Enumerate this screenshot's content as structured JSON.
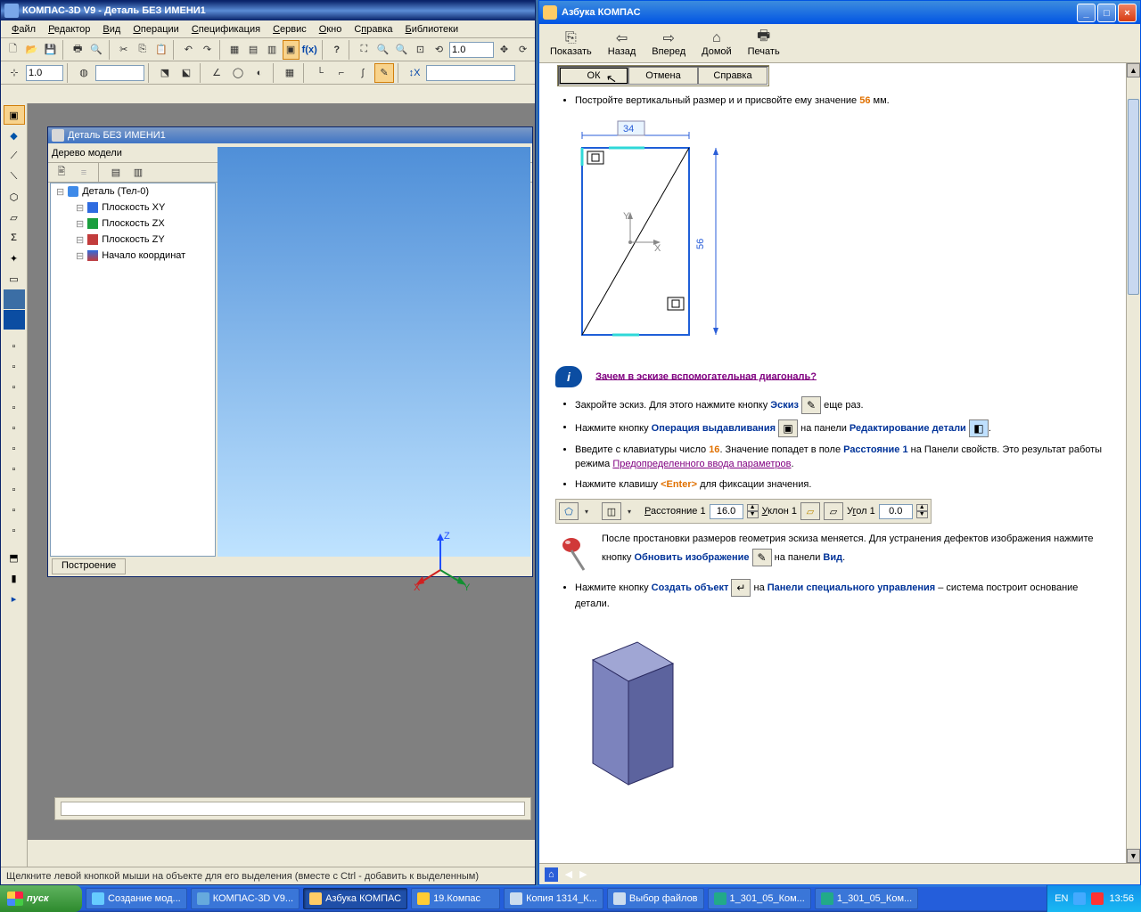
{
  "kompas": {
    "title": "КОМПАС-3D V9 - Деталь БЕЗ ИМЕНИ1",
    "menu": [
      "Файл",
      "Редактор",
      "Вид",
      "Операции",
      "Спецификация",
      "Сервис",
      "Окно",
      "Справка",
      "Библиотеки"
    ],
    "menu_underline": [
      0,
      0,
      0,
      0,
      0,
      0,
      0,
      1,
      0
    ],
    "zoom_input": "1.0",
    "tool_input1": "1.0",
    "mdi_title": "Деталь БЕЗ ИМЕНИ1",
    "tree_title": "Дерево модели",
    "tree_nodes": [
      {
        "label": "Деталь (Тел-0)",
        "cls": "part",
        "indent": 0
      },
      {
        "label": "Плоскость XY",
        "cls": "xy",
        "indent": 1
      },
      {
        "label": "Плоскость ZX",
        "cls": "zx",
        "indent": 1
      },
      {
        "label": "Плоскость ZY",
        "cls": "zy",
        "indent": 1
      },
      {
        "label": "Начало координат",
        "cls": "orig",
        "indent": 1
      }
    ],
    "tab": "Построение",
    "status": "Щелкните левой кнопкой мыши на объекте для его выделения (вместе с Ctrl - добавить к выделенным)",
    "axis_labels": {
      "x": "X",
      "y": "Y",
      "z": "Z"
    }
  },
  "help": {
    "title": "Азбука КОМПАС",
    "toolbar": [
      {
        "label": "Показать",
        "glyph": "⎘"
      },
      {
        "label": "Назад",
        "glyph": "⇦"
      },
      {
        "label": "Вперед",
        "glyph": "⇨"
      },
      {
        "label": "Домой",
        "glyph": "⌂"
      },
      {
        "label": "Печать",
        "glyph": "🖶"
      }
    ],
    "dlg": {
      "ok": "ОК",
      "cancel": "Отмена",
      "help": "Справка"
    },
    "dim_top": "34",
    "dim_right": "56",
    "axis_y": "Y",
    "axis_x": "X",
    "li1a": "Постройте вертикальный размер и и присвойте ему значение ",
    "li1b": "56",
    "li1c": " мм.",
    "info_q": "Зачем в эскизе вспомогательная диагональ?",
    "li2a": "Закройте эскиз. Для этого нажмите кнопку ",
    "li2b": "Эскиз",
    "li2c": " еще раз.",
    "li3a": "Нажмите кнопку ",
    "li3b": "Операция выдавливания",
    "li3c": " на панели ",
    "li3d": "Редактирование детали",
    "li3e": ".",
    "li4a": "Введите с клавиатуры число ",
    "li4b": "16",
    "li4c": ". Значение попадет в поле ",
    "li4d": "Расстояние 1",
    "li4e": " на Панели свойств. Это результат работы режима ",
    "li4f": "Предопределенного ввода параметров",
    "li4g": ".",
    "li5a": "Нажмите клавишу ",
    "li5b": "<Enter>",
    "li5c": " для фиксации значения.",
    "param": {
      "dist_label": "Расстояние 1",
      "dist_val": "16.0",
      "slope_label": "Уклон 1",
      "angle_label": "Угол 1",
      "angle_val": "0.0"
    },
    "note1a": "После простановки размеров геометрия эскиза меняется. Для устранения дефектов изображения нажмите кнопку ",
    "note1b": "Обновить изображение",
    "note1c": " на панели ",
    "note1d": "Вид",
    "note1e": ".",
    "li6a": "Нажмите кнопку ",
    "li6b": "Создать объект",
    "li6c": " на ",
    "li6d": "Панели специального управления",
    "li6e": " – система построит основание детали.",
    "status_icons": [
      "⌂",
      "◀",
      "▶"
    ]
  },
  "taskbar": {
    "start": "пуск",
    "items": [
      {
        "label": "Создание мод...",
        "active": false,
        "color": "#6cf"
      },
      {
        "label": "КОМПАС-3D V9...",
        "active": false,
        "color": "#6ad"
      },
      {
        "label": "Азбука КОМПАС",
        "active": true,
        "color": "#fc6"
      },
      {
        "label": "19.Компас",
        "active": false,
        "color": "#fc3"
      },
      {
        "label": "Копия 1314_К...",
        "active": false,
        "color": "#cde"
      },
      {
        "label": "Выбор файлов",
        "active": false,
        "color": "#cde"
      },
      {
        "label": "1_301_05_Ком...",
        "active": false,
        "color": "#2a8"
      },
      {
        "label": "1_301_05_Ком...",
        "active": false,
        "color": "#2a8"
      }
    ],
    "lang": "EN",
    "time": "13:56"
  }
}
